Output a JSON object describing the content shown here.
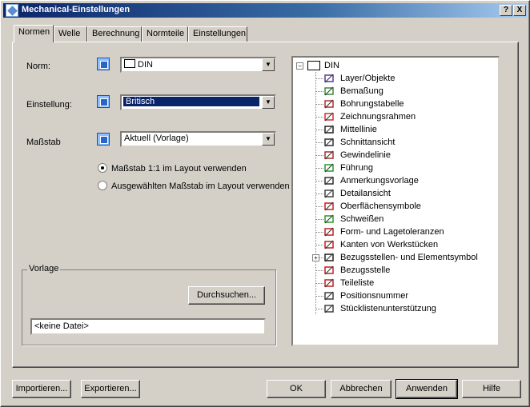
{
  "window": {
    "title": "Mechanical-Einstellungen",
    "help_btn": "?",
    "close_btn": "X"
  },
  "tabs": [
    "Normen",
    "Welle",
    "Berechnung",
    "Normteile",
    "Einstellungen"
  ],
  "form": {
    "norm_label": "Norm:",
    "norm_value": "DIN",
    "einstellung_label": "Einstellung:",
    "einstellung_value": "Britisch",
    "massstab_label": "Maßstab",
    "massstab_value": "Aktuell (Vorlage)",
    "radio1": "Maßstab 1:1 im Layout verwenden",
    "radio2": "Ausgewählten Maßstab im Layout verwenden",
    "radio_selected": 1
  },
  "vorlage": {
    "legend": "Vorlage",
    "browse_button": "Durchsuchen...",
    "file_value": "<keine Datei>"
  },
  "tree": {
    "root": "DIN",
    "items": [
      {
        "label": "Layer/Objekte",
        "icon": "layer-icon"
      },
      {
        "label": "Bemaßung",
        "icon": "dimension-icon"
      },
      {
        "label": "Bohrungstabelle",
        "icon": "hole-table-icon"
      },
      {
        "label": "Zeichnungsrahmen",
        "icon": "title-block-icon"
      },
      {
        "label": "Mittellinie",
        "icon": "centerline-icon"
      },
      {
        "label": "Schnittansicht",
        "icon": "section-view-icon"
      },
      {
        "label": "Gewindelinie",
        "icon": "thread-icon"
      },
      {
        "label": "Führung",
        "icon": "leader-icon"
      },
      {
        "label": "Anmerkungsvorlage",
        "icon": "note-template-icon"
      },
      {
        "label": "Detailansicht",
        "icon": "detail-view-icon"
      },
      {
        "label": "Oberflächensymbole",
        "icon": "surface-symbol-icon"
      },
      {
        "label": "Schweißen",
        "icon": "weld-icon"
      },
      {
        "label": "Form- und Lagetoleranzen",
        "icon": "tolerance-icon"
      },
      {
        "label": "Kanten von Werkstücken",
        "icon": "edge-icon"
      },
      {
        "label": "Bezugsstellen- und Elementsymbol",
        "icon": "datum-icon"
      },
      {
        "label": "Bezugsstelle",
        "icon": "datum-target-icon"
      },
      {
        "label": "Teileliste",
        "icon": "parts-list-icon"
      },
      {
        "label": "Positionsnummer",
        "icon": "balloon-icon"
      },
      {
        "label": "Stücklistenunterstützung",
        "icon": "bom-icon"
      }
    ]
  },
  "buttons": {
    "import": "Importieren...",
    "export": "Exportieren...",
    "ok": "OK",
    "cancel": "Abbrechen",
    "apply": "Anwenden",
    "help": "Hilfe"
  }
}
